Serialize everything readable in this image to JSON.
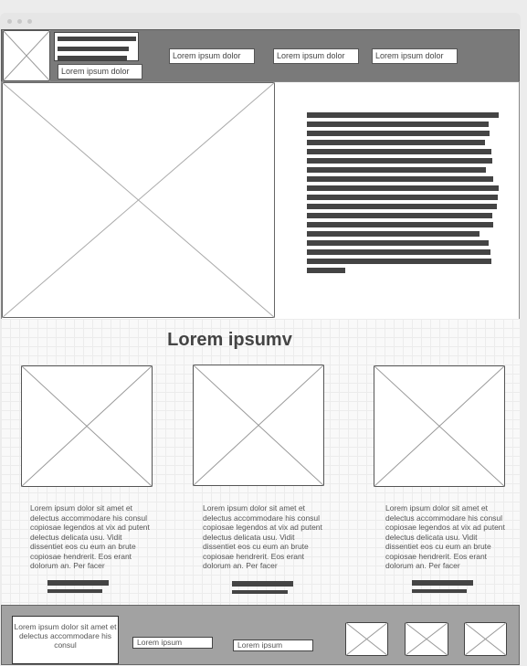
{
  "header": {
    "logo_caption": "Lorem ipsum dolor",
    "nav": [
      {
        "label": "Lorem ipsum dolor"
      },
      {
        "label": "Lorem ipsum dolor"
      },
      {
        "label": "Lorem ipsum dolor"
      }
    ]
  },
  "section": {
    "title": "Lorem ipsumv",
    "cards": [
      {
        "text": "Lorem ipsum dolor sit amet et delectus accommodare his consul copiosae legendos at vix ad putent delectus delicata usu. Vidit dissentiet eos cu eum an brute copiosae hendrerit. Eos erant dolorum an. Per facer"
      },
      {
        "text": "Lorem ipsum dolor sit amet et delectus accommodare his consul copiosae legendos at vix ad putent delectus delicata usu. Vidit dissentiet eos cu eum an brute copiosae hendrerit. Eos erant dolorum an. Per facer"
      },
      {
        "text": "Lorem ipsum dolor sit amet et delectus accommodare his consul copiosae legendos at vix ad putent delectus delicata usu. Vidit dissentiet eos cu eum an brute copiosae hendrerit. Eos erant dolorum an. Per facer"
      }
    ]
  },
  "footer": {
    "about": "Lorem ipsum dolor sit amet et delectus accommodare his consul",
    "link_1": "Lorem ipsum",
    "link_2": "Lorem ipsum"
  }
}
